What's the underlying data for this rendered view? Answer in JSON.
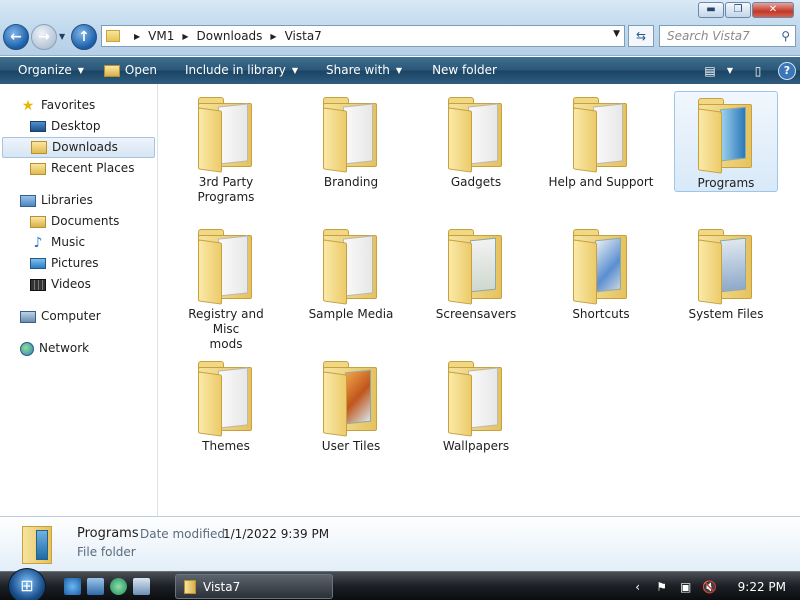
{
  "window": {
    "controls": {
      "minimize": "▬",
      "maximize": "❐",
      "close": "✕"
    },
    "nav": {
      "back": "←",
      "forward": "→",
      "up": "↑",
      "dropdown": "▼"
    },
    "address": {
      "crumbs": [
        "VM1",
        "Downloads",
        "Vista7"
      ],
      "separator": "▶",
      "dropdown": "▼"
    },
    "refresh": "⇆",
    "search": {
      "placeholder": "Search Vista7",
      "icon": "⚲"
    }
  },
  "toolbar": {
    "organize": "Organize",
    "open": "Open",
    "include_in_library": "Include in library",
    "share_with": "Share with",
    "new_folder": "New folder",
    "arrow": "▼",
    "views": "▤",
    "pane": "▯",
    "help": "?"
  },
  "sidebar": {
    "favorites": {
      "label": "Favorites",
      "icon": "★",
      "items": [
        "Desktop",
        "Downloads",
        "Recent Places"
      ]
    },
    "libraries": {
      "label": "Libraries",
      "items": [
        "Documents",
        "Music",
        "Pictures",
        "Videos"
      ],
      "music_icon": "♪"
    },
    "computer": "Computer",
    "network": "Network"
  },
  "folders": [
    {
      "name": "3rd Party Programs",
      "line1": "3rd Party",
      "line2": "Programs"
    },
    {
      "name": "Branding",
      "line1": "Branding",
      "line2": ""
    },
    {
      "name": "Gadgets",
      "line1": "Gadgets",
      "line2": ""
    },
    {
      "name": "Help and Support",
      "line1": "Help and Support",
      "line2": ""
    },
    {
      "name": "Programs",
      "line1": "Programs",
      "line2": "",
      "selected": true
    },
    {
      "name": "Registry and Misc mods",
      "line1": "Registry and Misc",
      "line2": "mods"
    },
    {
      "name": "Sample Media",
      "line1": "Sample Media",
      "line2": ""
    },
    {
      "name": "Screensavers",
      "line1": "Screensavers",
      "line2": ""
    },
    {
      "name": "Shortcuts",
      "line1": "Shortcuts",
      "line2": ""
    },
    {
      "name": "System Files",
      "line1": "System Files",
      "line2": ""
    },
    {
      "name": "Themes",
      "line1": "Themes",
      "line2": ""
    },
    {
      "name": "User Tiles",
      "line1": "User Tiles",
      "line2": ""
    },
    {
      "name": "Wallpapers",
      "line1": "Wallpapers",
      "line2": ""
    }
  ],
  "details": {
    "name": "Programs",
    "date_modified_label": "Date modified:",
    "date_modified": "1/1/2022 9:39 PM",
    "type": "File folder"
  },
  "taskbar": {
    "start_icon": "⊞",
    "window_button": "Vista7",
    "tray_chevron": "‹",
    "tray_flag": "⚑",
    "tray_net": "▣",
    "tray_sound": "🔇",
    "time": "9:22 PM"
  },
  "colors": {
    "selection": "#d8e9f8",
    "command_bar": "#2b5779",
    "folder": "#e6c25e"
  }
}
